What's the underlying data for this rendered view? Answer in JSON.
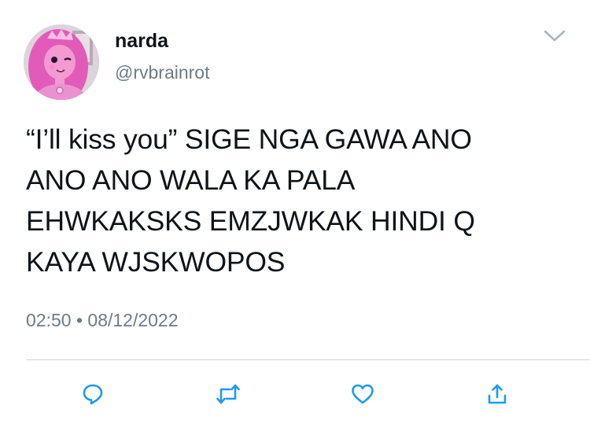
{
  "tweet": {
    "display_name": "narda",
    "handle": "@rvbrainrot",
    "text_lines": [
      "“I’ll kiss you” SIGE NGA GAWA ANO",
      "ANO ANO WALA KA PALA",
      "EHWKAKSKS EMZJWKAK HINDI Q",
      "KAYA WJSKWOPOS"
    ],
    "time": "02:50",
    "separator": "•",
    "date": "08/12/2022"
  },
  "icons": {
    "more": "chevron-down-icon",
    "reply": "reply-icon",
    "retweet": "retweet-icon",
    "like": "heart-icon",
    "share": "share-icon"
  },
  "colors": {
    "text": "#0f1419",
    "secondary": "#6e7b87",
    "icon": "#1d9bf0",
    "divider": "#d2d7db",
    "avatar_pink": "#e35bb8"
  }
}
